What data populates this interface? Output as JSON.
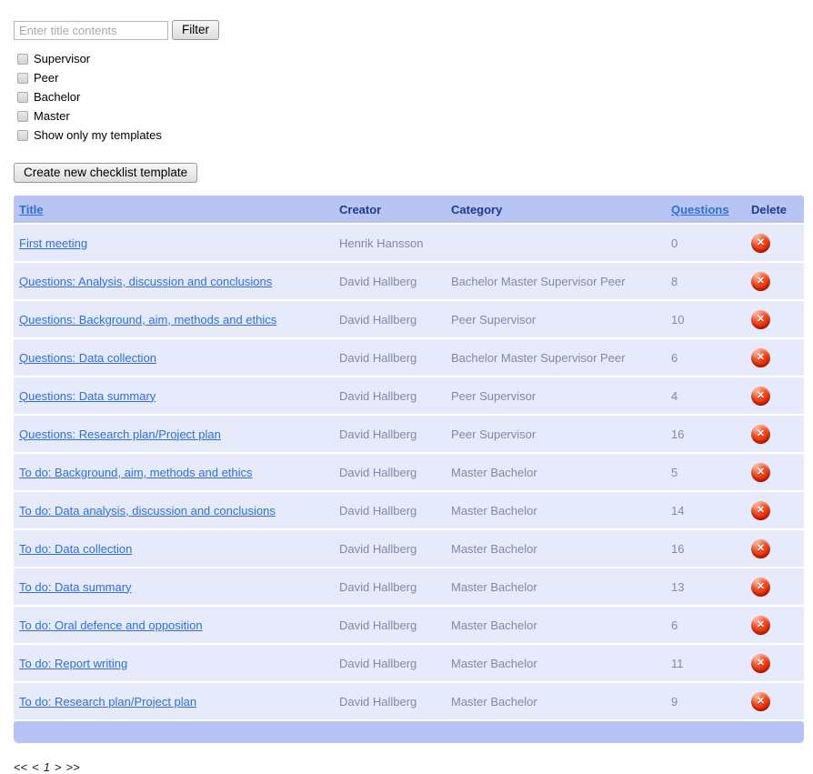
{
  "filter": {
    "input_placeholder": "Enter title contents",
    "button_label": "Filter",
    "checkboxes": [
      {
        "label": "Supervisor",
        "checked": false
      },
      {
        "label": "Peer",
        "checked": false
      },
      {
        "label": "Bachelor",
        "checked": false
      },
      {
        "label": "Master",
        "checked": false
      },
      {
        "label": "Show only my templates",
        "checked": false
      }
    ]
  },
  "create_button_label": "Create new checklist template",
  "table": {
    "columns": [
      {
        "label": "Title",
        "sortable_link": true
      },
      {
        "label": "Creator",
        "sortable_link": false
      },
      {
        "label": "Category",
        "sortable_link": false
      },
      {
        "label": "Questions",
        "sortable_link": true
      },
      {
        "label": "Delete",
        "sortable_link": false
      }
    ],
    "rows": [
      {
        "title": "First meeting",
        "creator": "Henrik Hansson",
        "category": "",
        "questions": "0"
      },
      {
        "title": "Questions: Analysis, discussion and conclusions",
        "creator": "David Hallberg",
        "category": "Bachelor Master Supervisor Peer",
        "questions": "8"
      },
      {
        "title": "Questions: Background, aim, methods and ethics",
        "creator": "David Hallberg",
        "category": "Peer Supervisor",
        "questions": "10"
      },
      {
        "title": "Questions: Data collection",
        "creator": "David Hallberg",
        "category": "Bachelor Master Supervisor Peer",
        "questions": "6"
      },
      {
        "title": "Questions: Data summary",
        "creator": "David Hallberg",
        "category": "Peer Supervisor",
        "questions": "4"
      },
      {
        "title": "Questions: Research plan/Project plan",
        "creator": "David Hallberg",
        "category": "Peer Supervisor",
        "questions": "16"
      },
      {
        "title": "To do: Background, aim, methods and ethics",
        "creator": "David Hallberg",
        "category": "Master Bachelor",
        "questions": "5"
      },
      {
        "title": "To do: Data analysis, discussion and conclusions",
        "creator": "David Hallberg",
        "category": "Master Bachelor",
        "questions": "14"
      },
      {
        "title": "To do: Data collection",
        "creator": "David Hallberg",
        "category": "Master Bachelor",
        "questions": "16"
      },
      {
        "title": "To do: Data summary",
        "creator": "David Hallberg",
        "category": "Master Bachelor",
        "questions": "13"
      },
      {
        "title": "To do: Oral defence and opposition",
        "creator": "David Hallberg",
        "category": "Master Bachelor",
        "questions": "6"
      },
      {
        "title": "To do: Report writing",
        "creator": "David Hallberg",
        "category": "Master Bachelor",
        "questions": "11"
      },
      {
        "title": "To do: Research plan/Project plan",
        "creator": "David Hallberg",
        "category": "Master Bachelor",
        "questions": "9"
      }
    ],
    "delete_icon_glyph": "✕"
  },
  "pagination": {
    "first": "<<",
    "prev": "<",
    "current": "1",
    "next": ">",
    "last": ">>"
  },
  "colors": {
    "header_bg": "#b8c4f2",
    "row_bg": "#e6eafb",
    "footer_bg": "#b6c2f3",
    "link_blue": "#2e6fd8",
    "header_text": "#1f3a8f",
    "muted_text": "#8487a8",
    "delete_red": "#e92f02"
  }
}
